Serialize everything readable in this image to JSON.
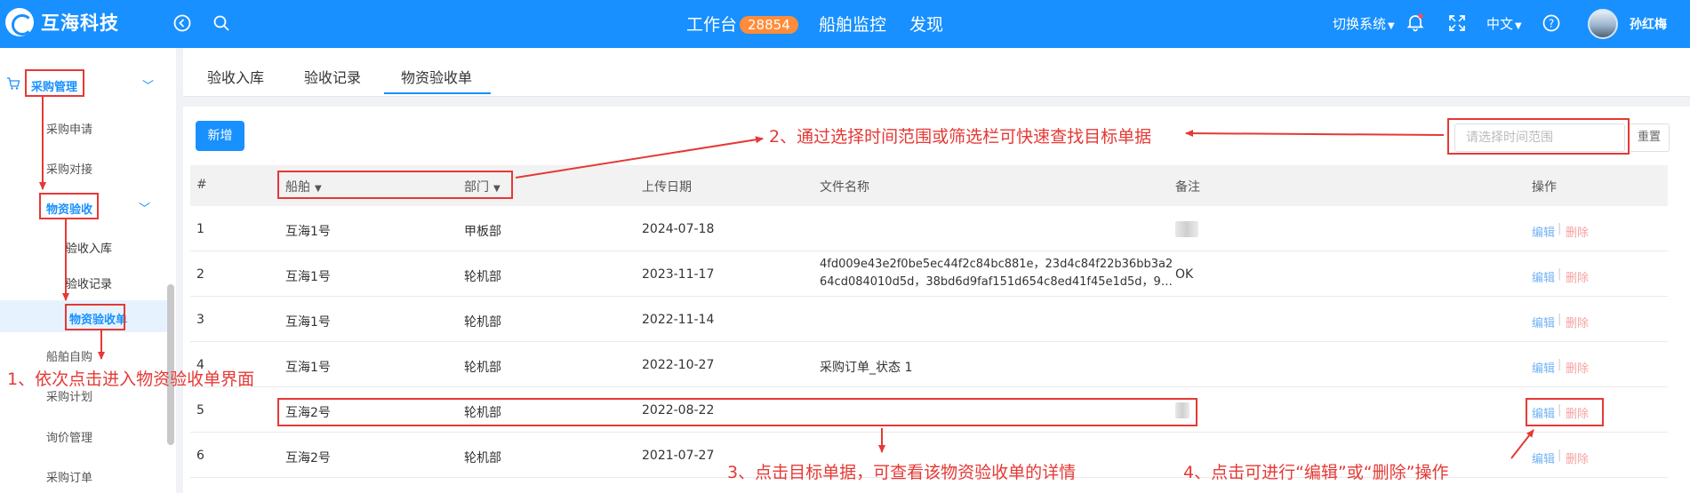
{
  "header": {
    "brand": "互海科技",
    "nav": {
      "workbench": "工作台",
      "workbench_badge": "28854",
      "ship_monitor": "船舶监控",
      "discover": "发现"
    },
    "switch_system": "切换系统",
    "language": "中文",
    "user_name": "孙红梅"
  },
  "sidebar": {
    "procurement": "采购管理",
    "purchase_request": "采购申请",
    "purchase_docking": "采购对接",
    "material_acceptance": "物资验收",
    "acceptance_in": "验收入库",
    "acceptance_record": "验收记录",
    "material_acceptance_form": "物资验收单",
    "ship_self_purchase": "船舶自购",
    "purchase_plan": "采购计划",
    "inquiry_management": "询价管理",
    "purchase_order": "采购订单"
  },
  "tabs": [
    "验收入库",
    "验收记录",
    "物资验收单"
  ],
  "toolbar": {
    "add_label": "新增",
    "date_placeholder": "请选择时间范围",
    "reset_label": "重置"
  },
  "table": {
    "headers": {
      "index": "#",
      "ship": "船舶",
      "department": "部门",
      "upload_date": "上传日期",
      "file_name": "文件名称",
      "remark": "备注",
      "actions": "操作"
    },
    "edit_label": "编辑",
    "delete_label": "删除",
    "rows": [
      {
        "index": "1",
        "ship": "互海1号",
        "department": "甲板部",
        "date": "2024-07-18",
        "file_line1": "",
        "file_line2": "",
        "remark": ""
      },
      {
        "index": "2",
        "ship": "互海1号",
        "department": "轮机部",
        "date": "2023-11-17",
        "file_line1": "4fd009e43e2f0be5ec44f2c84bc881e，23d4c84f22b36bb3a2",
        "file_line2": "64cd084010d5d，38bd6d9faf151d654c8ed41f45e1d5d，9…",
        "remark": "OK"
      },
      {
        "index": "3",
        "ship": "互海1号",
        "department": "轮机部",
        "date": "2022-11-14",
        "file_line1": "",
        "file_line2": "",
        "remark": ""
      },
      {
        "index": "4",
        "ship": "互海1号",
        "department": "轮机部",
        "date": "2022-10-27",
        "file_line1": "采购订单_状态 1",
        "file_line2": "",
        "remark": ""
      },
      {
        "index": "5",
        "ship": "互海2号",
        "department": "轮机部",
        "date": "2022-08-22",
        "file_line1": "",
        "file_line2": "",
        "remark": ""
      },
      {
        "index": "6",
        "ship": "互海2号",
        "department": "轮机部",
        "date": "2021-07-27",
        "file_line1": "",
        "file_line2": "",
        "remark": ""
      }
    ]
  },
  "annotations": {
    "step1": "1、依次点击进入物资验收单界面",
    "step2": "2、通过选择时间范围或筛选栏可快速查找目标单据",
    "step3": "3、点击目标单据，可查看该物资验收单的详情",
    "step4": "4、点击可进行“编辑”或“删除”操作"
  },
  "colors": {
    "primary": "#1890ff",
    "annotation": "#e53935",
    "badge": "#ff8c3a"
  }
}
